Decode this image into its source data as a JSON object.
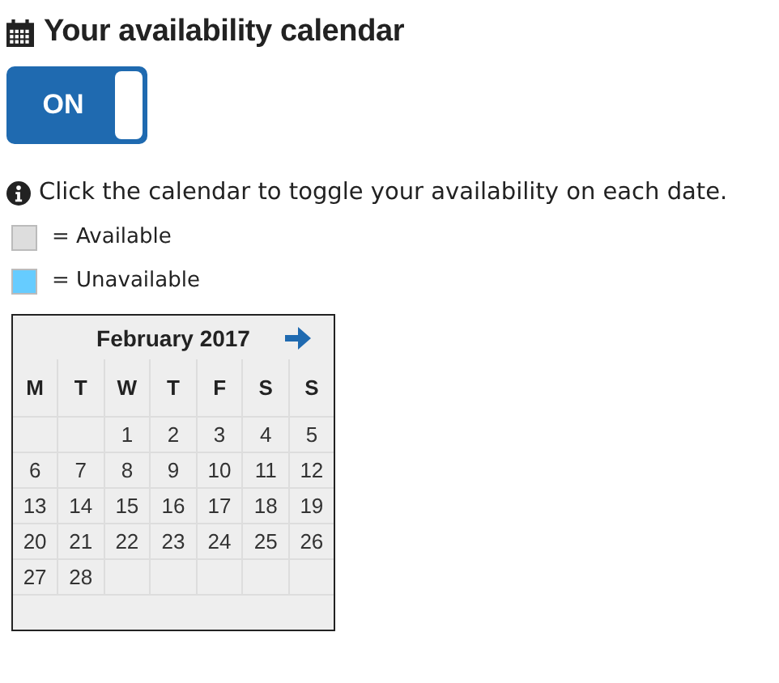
{
  "heading": "Your availability calendar",
  "toggle": {
    "label": "ON",
    "on": true
  },
  "info": "Click the calendar to toggle your availability on each date.",
  "legend": [
    {
      "label": "= Available",
      "color": "#dddddd"
    },
    {
      "label": "= Unavailable",
      "color": "#66ccff"
    }
  ],
  "calendar": {
    "month": "February 2017",
    "weekdays": [
      "M",
      "T",
      "W",
      "T",
      "F",
      "S",
      "S"
    ],
    "weeks": [
      [
        {
          "kind": "blank"
        },
        {
          "kind": "blank"
        },
        {
          "kind": "date",
          "day": "1",
          "unavailable": false
        },
        {
          "kind": "date",
          "day": "2",
          "unavailable": false
        },
        {
          "kind": "date",
          "day": "3",
          "unavailable": false
        },
        {
          "kind": "date",
          "day": "4",
          "unavailable": false
        },
        {
          "kind": "date",
          "day": "5",
          "unavailable": false
        }
      ],
      [
        {
          "kind": "date",
          "day": "6",
          "unavailable": false
        },
        {
          "kind": "date",
          "day": "7",
          "unavailable": false
        },
        {
          "kind": "date",
          "day": "8",
          "unavailable": false
        },
        {
          "kind": "date",
          "day": "9",
          "unavailable": false
        },
        {
          "kind": "date",
          "day": "10",
          "unavailable": false
        },
        {
          "kind": "date",
          "day": "11",
          "unavailable": false
        },
        {
          "kind": "date",
          "day": "12",
          "unavailable": false
        }
      ],
      [
        {
          "kind": "date",
          "day": "13",
          "unavailable": false
        },
        {
          "kind": "date",
          "day": "14",
          "unavailable": false
        },
        {
          "kind": "date",
          "day": "15",
          "unavailable": false
        },
        {
          "kind": "date",
          "day": "16",
          "unavailable": false
        },
        {
          "kind": "date",
          "day": "17",
          "unavailable": false
        },
        {
          "kind": "date",
          "day": "18",
          "unavailable": false
        },
        {
          "kind": "date",
          "day": "19",
          "unavailable": false
        }
      ],
      [
        {
          "kind": "date",
          "day": "20",
          "unavailable": false
        },
        {
          "kind": "date",
          "day": "21",
          "unavailable": false
        },
        {
          "kind": "date",
          "day": "22",
          "unavailable": false
        },
        {
          "kind": "date",
          "day": "23",
          "unavailable": false
        },
        {
          "kind": "date",
          "day": "24",
          "unavailable": false
        },
        {
          "kind": "date",
          "day": "25",
          "unavailable": false
        },
        {
          "kind": "date",
          "day": "26",
          "unavailable": false
        }
      ],
      [
        {
          "kind": "date",
          "day": "27",
          "unavailable": false
        },
        {
          "kind": "date",
          "day": "28",
          "unavailable": false
        },
        {
          "kind": "blank"
        },
        {
          "kind": "blank"
        },
        {
          "kind": "blank"
        },
        {
          "kind": "blank"
        },
        {
          "kind": "blank"
        }
      ]
    ]
  }
}
